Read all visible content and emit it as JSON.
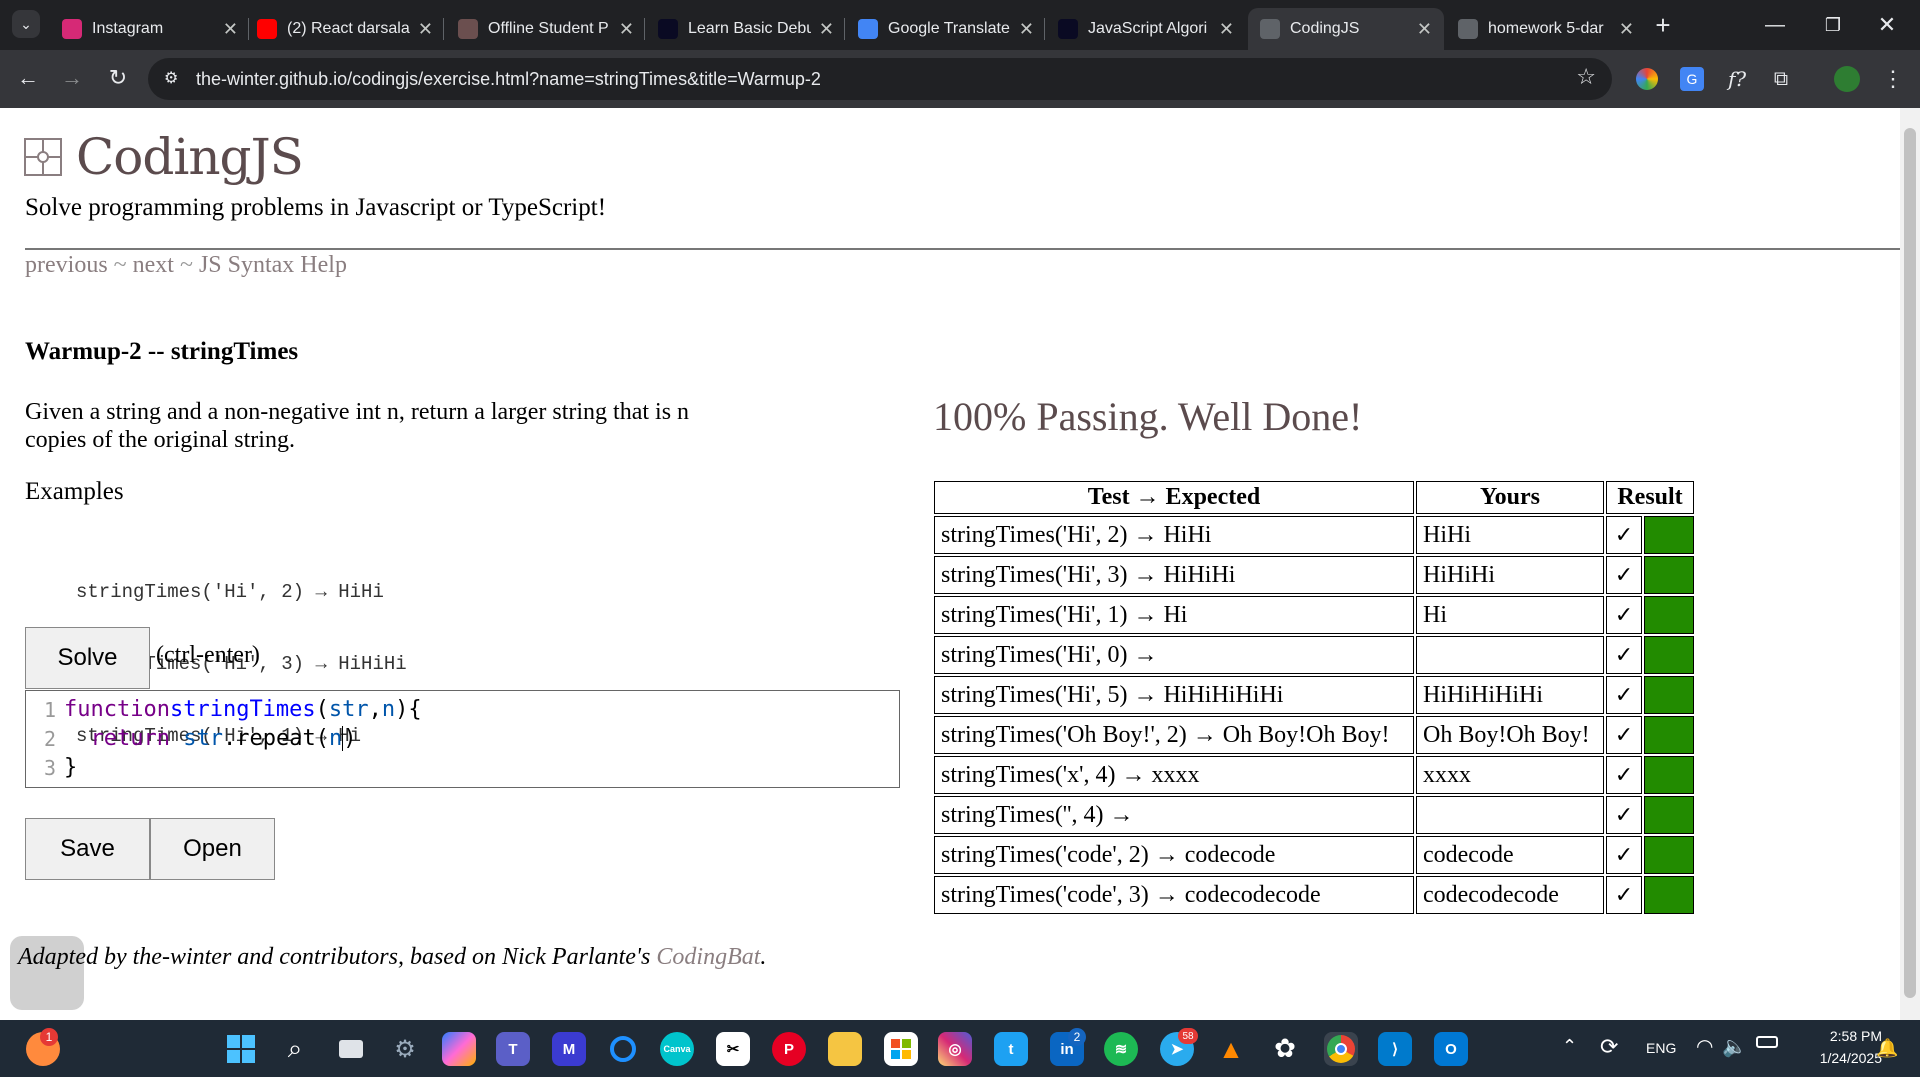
{
  "browser": {
    "tabs": [
      {
        "title": "Instagram",
        "icon": "instagram-icon",
        "color": "#d62976"
      },
      {
        "title": "(2) React darsala",
        "icon": "youtube-icon",
        "color": "#ff0000"
      },
      {
        "title": "Offline Student P",
        "icon": "student-portal-icon",
        "color": "#6b4f4f"
      },
      {
        "title": "Learn Basic Debu",
        "icon": "freecodecamp-icon",
        "color": "#0a0a23"
      },
      {
        "title": "Google Translate",
        "icon": "google-translate-icon",
        "color": "#4285f4"
      },
      {
        "title": "JavaScript Algori",
        "icon": "freecodecamp-icon",
        "color": "#0a0a23"
      },
      {
        "title": "CodingJS",
        "icon": "globe-icon",
        "color": "#5f6368"
      },
      {
        "title": "homework 5-dar",
        "icon": "globe-icon",
        "color": "#5f6368"
      }
    ],
    "url": "the-winter.github.io/codingjs/exercise.html?name=stringTimes&title=Warmup-2"
  },
  "page": {
    "logo_text": "CodingJS",
    "tagline": "Solve programming problems in Javascript or TypeScript!",
    "nav": {
      "previous": "previous",
      "sep1": " ~ ",
      "next": "next",
      "sep2": " ~ ",
      "help": "JS Syntax Help"
    },
    "exercise_title": "Warmup-2 -- stringTimes",
    "description": "Given a string and a non-negative int n, return a larger string that is n copies of the original string.",
    "examples_heading": "Examples",
    "examples": [
      "stringTimes('Hi', 2) → HiHi",
      "stringTimes('Hi', 3) → HiHiHi",
      "stringTimes('Hi', 1) → Hi"
    ],
    "solve_label": "Solve",
    "solve_hint": "(ctrl-enter)",
    "code_lines": [
      {
        "num": "1",
        "kw": "function",
        "fn": " stringTimes",
        "rest": "(",
        "a": "str",
        "b": ", ",
        "c": "n",
        "d": "){"
      },
      {
        "num": "2",
        "kw": "  return",
        "fn": "",
        "rest": " ",
        "a": "str",
        "b": ".repeat(",
        "c": "n",
        "d": ")"
      },
      {
        "num": "3",
        "kw": "",
        "fn": "",
        "rest": "}",
        "a": "",
        "b": "",
        "c": "",
        "d": ""
      }
    ],
    "save_label": "Save",
    "open_label": "Open",
    "status": "100% Passing. Well Done!",
    "table": {
      "headers": [
        "Test → Expected",
        "Yours",
        "Result"
      ],
      "rows": [
        {
          "test": "stringTimes('Hi', 2) → HiHi",
          "yours": "HiHi",
          "result": "✓"
        },
        {
          "test": "stringTimes('Hi', 3) → HiHiHi",
          "yours": "HiHiHi",
          "result": "✓"
        },
        {
          "test": "stringTimes('Hi', 1) → Hi",
          "yours": "Hi",
          "result": "✓"
        },
        {
          "test": "stringTimes('Hi', 0) →",
          "yours": "",
          "result": "✓"
        },
        {
          "test": "stringTimes('Hi', 5) → HiHiHiHiHi",
          "yours": "HiHiHiHiHi",
          "result": "✓"
        },
        {
          "test": "stringTimes('Oh Boy!', 2) → Oh Boy!Oh Boy!",
          "yours": "Oh Boy!Oh Boy!",
          "result": "✓"
        },
        {
          "test": "stringTimes('x', 4) → xxxx",
          "yours": "xxxx",
          "result": "✓"
        },
        {
          "test": "stringTimes('', 4) →",
          "yours": "",
          "result": "✓"
        },
        {
          "test": "stringTimes('code', 2) → codecode",
          "yours": "codecode",
          "result": "✓"
        },
        {
          "test": "stringTimes('code', 3) → codecodecode",
          "yours": "codecodecode",
          "result": "✓"
        }
      ],
      "pass_color": "#228b00"
    },
    "footer_text": "Adapted by the-winter and contributors, based on Nick Parlante's ",
    "footer_link": "CodingBat",
    "footer_end": "."
  },
  "taskbar": {
    "lang": "ENG",
    "time": "2:58 PM",
    "date": "1/24/2025",
    "badges": {
      "start": "1",
      "linkedin": "2",
      "telegram": "58"
    }
  }
}
